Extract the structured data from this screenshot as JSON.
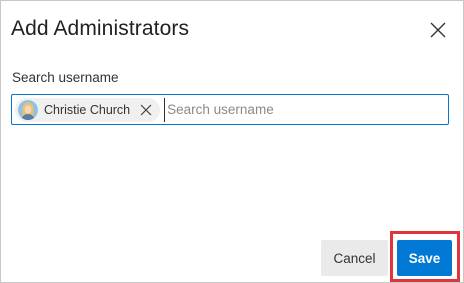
{
  "dialog": {
    "title": "Add Administrators",
    "close_icon": "close-icon"
  },
  "search": {
    "label": "Search username",
    "placeholder": "Search username",
    "value": ""
  },
  "selected_users": [
    {
      "name": "Christie Church",
      "avatar_icon": "user-avatar-icon",
      "remove_icon": "close-icon"
    }
  ],
  "footer": {
    "cancel_label": "Cancel",
    "save_label": "Save"
  },
  "colors": {
    "accent": "#0078d4",
    "highlight": "#e0353c",
    "cancel_bg": "#eaeaea",
    "chip_bg": "#f0f0f0"
  }
}
